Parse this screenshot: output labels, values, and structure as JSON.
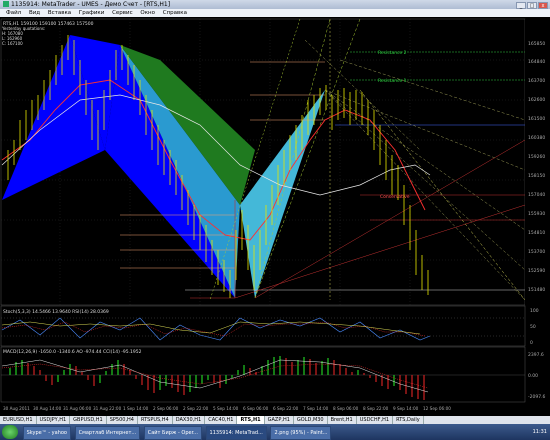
{
  "window": {
    "title": "1135914: MetaTrader - UMES - Демо Счет - [RTS,H1]",
    "buttons": [
      "_",
      "□",
      "x"
    ]
  },
  "menu": [
    "Файл",
    "Вид",
    "Вставка",
    "Графики",
    "Сервис",
    "Окно",
    "Справка"
  ],
  "chart_header": {
    "symbol_line": "RTS,H1  159100 159100 157463 157500",
    "quote_title": "Yesterday quotations:",
    "quote_h": "H: 167080",
    "quote_l": "L: 162960",
    "quote_c": "C: 167100"
  },
  "labels": {
    "right1": "Resistance 2",
    "right2": "Resistance 1",
    "band": "Conservative"
  },
  "price_axis": [
    "165850",
    "164840",
    "163700",
    "162600",
    "161500",
    "160380",
    "159260",
    "158150",
    "157040",
    "155930",
    "154810",
    "153700",
    "152590",
    "151480"
  ],
  "stoch_header": "Stoch(5,3,3) 14.5466 13.9640  RSI(14) 28.0369",
  "macd_header": "MACD(12,26,9) -1650.0 -1340.6  AO -974.44  CCI(14) -95.1952",
  "stoch_axis": [
    "100",
    "50",
    "0"
  ],
  "macd_axis": [
    "2397.6",
    "0.00",
    "-2097.6"
  ],
  "time_axis": [
    "30 Aug 2011",
    "30 Aug 14:00",
    "31 Aug 06:00",
    "31 Aug 22:00",
    "1 Sep 14:00",
    "2 Sep 06:00",
    "2 Sep 22:00",
    "5 Sep 14:00",
    "6 Sep 06:00",
    "6 Sep 22:00",
    "7 Sep 14:00",
    "8 Sep 06:00",
    "8 Sep 22:00",
    "9 Sep 14:00",
    "12 Sep 06:00"
  ],
  "tabs": [
    "EURUSD,H1",
    "USDJPY,H1",
    "GBPUSD,H1",
    "SP500,H4",
    "RTSPUS,H4",
    "DAX30,H1",
    "CAC40,H1",
    "RTS,H1",
    "GAZP,H1",
    "GOLD,M30",
    "Brent,H1",
    "USDCHF,H1",
    "RTS,Daily"
  ],
  "active_tab": "RTS,H1",
  "taskbar": {
    "items": [
      "Skype™ - yahoo",
      "Смартлаб Интернет...",
      "Сайт Бирж - Oper...",
      "1135914: MetaTrad...",
      "2.png (95%) - Paint..."
    ],
    "clock": "11:31"
  },
  "colors": {
    "blue_pattern": "#0000ff",
    "green_pattern": "#1f7a1f",
    "teal_pattern": "#44b8d8",
    "price_candles": "#e6e600",
    "ma_red": "#ff3030",
    "ma_white": "#e8e8e8"
  }
}
